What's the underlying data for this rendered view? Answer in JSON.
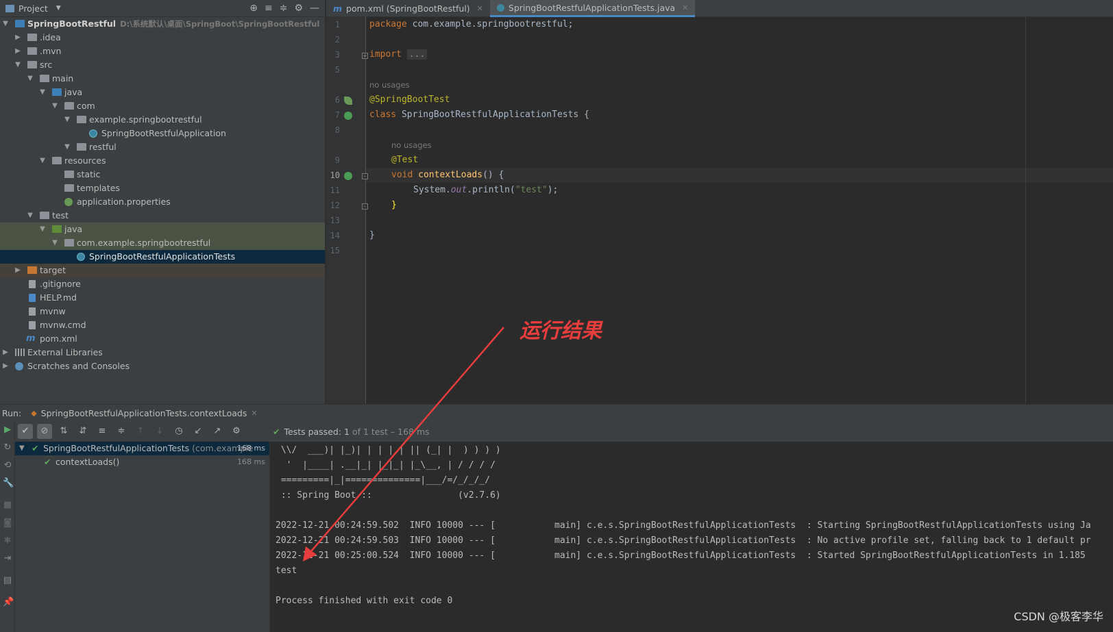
{
  "project": {
    "title": "Project",
    "tree": [
      {
        "label": "SpringBootRestful",
        "path": "D:\\系统默认\\桌面\\SpringBoot\\SpringBootRestful"
      },
      {
        "label": ".idea"
      },
      {
        "label": ".mvn"
      },
      {
        "label": "src"
      },
      {
        "label": "main"
      },
      {
        "label": "java"
      },
      {
        "label": "com"
      },
      {
        "label": "example.springbootrestful"
      },
      {
        "label": "SpringBootRestfulApplication"
      },
      {
        "label": "restful"
      },
      {
        "label": "resources"
      },
      {
        "label": "static"
      },
      {
        "label": "templates"
      },
      {
        "label": "application.properties"
      },
      {
        "label": "test"
      },
      {
        "label": "java"
      },
      {
        "label": "com.example.springbootrestful"
      },
      {
        "label": "SpringBootRestfulApplicationTests"
      },
      {
        "label": "target"
      },
      {
        "label": ".gitignore"
      },
      {
        "label": "HELP.md"
      },
      {
        "label": "mvnw"
      },
      {
        "label": "mvnw.cmd"
      },
      {
        "label": "pom.xml"
      },
      {
        "label": "External Libraries"
      },
      {
        "label": "Scratches and Consoles"
      }
    ]
  },
  "editor": {
    "tabs": [
      {
        "label": "pom.xml (SpringBootRestful)"
      },
      {
        "label": "SpringBootRestfulApplicationTests.java"
      }
    ],
    "line_numbers": [
      "1",
      "2",
      "3",
      "5",
      "6",
      "7",
      "8",
      "9",
      "10",
      "11",
      "12",
      "13",
      "14",
      "15"
    ],
    "hints": [
      "no usages",
      "no usages"
    ],
    "code": {
      "l1_kw": "package",
      "l1_rest": " com.example.springbootrestful;",
      "l3_kw": "import",
      "l3_fold": "...",
      "l6_ann": "@SpringBootTest",
      "l7_kw": "class",
      "l7_rest": " SpringBootRestfulApplicationTests {",
      "l9_ann": "@Test",
      "l10_kw": "void",
      "l10_fn": "contextLoads",
      "l10_rest": "() {",
      "l11_a": "System.",
      "l11_st": "out",
      "l11_b": ".println(",
      "l11_str": "\"test\"",
      "l11_c": ");",
      "l12": "}",
      "l14": "}"
    }
  },
  "annotation": {
    "label": "运行结果"
  },
  "run": {
    "label": "Run:",
    "tab": "SpringBootRestfulApplicationTests.contextLoads",
    "status_passed": "Tests passed:",
    "status_count": "1",
    "status_rest": "of 1 test – 168 ms",
    "tree": [
      {
        "name": "SpringBootRestfulApplicationTests",
        "pkg": "(com.example",
        "time": "168 ms"
      },
      {
        "name": "contextLoads()",
        "time": "168 ms"
      }
    ],
    "console": [
      " \\\\/  ___)| |_)| | | | | || (_| |  ) ) ) )",
      "  '  |____| .__|_| |_|_| |_\\__, | / / / /",
      " =========|_|==============|___/=/_/_/_/",
      " :: Spring Boot ::                (v2.7.6)",
      "",
      "2022-12-21 00:24:59.502  INFO 10000 --- [           main] c.e.s.SpringBootRestfulApplicationTests  : Starting SpringBootRestfulApplicationTests using Ja",
      "2022-12-21 00:24:59.503  INFO 10000 --- [           main] c.e.s.SpringBootRestfulApplicationTests  : No active profile set, falling back to 1 default pr",
      "2022-12-21 00:25:00.524  INFO 10000 --- [           main] c.e.s.SpringBootRestfulApplicationTests  : Started SpringBootRestfulApplicationTests in 1.185",
      "test",
      "",
      "Process finished with exit code 0"
    ]
  },
  "watermark": "CSDN @极客李华",
  "colors": {
    "accent": "#4a88c7",
    "pass": "#5ea65a",
    "annotation": "#e83d3d"
  }
}
